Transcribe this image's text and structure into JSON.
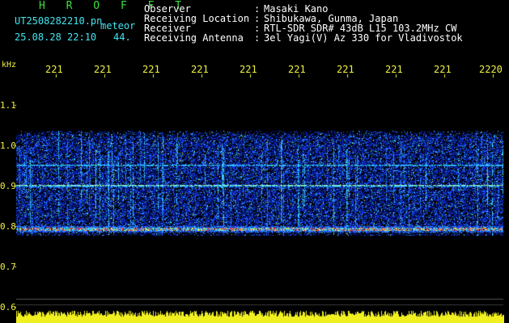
{
  "header": {
    "station": "H R O F F T",
    "file_name": "UT2508282210.pn",
    "category": "meteor",
    "datetime": "25.08.28 22:10",
    "param_value": "44."
  },
  "info": [
    {
      "label": "Observer",
      "value": "Masaki Kano"
    },
    {
      "label": "Receiving Location",
      "value": "Shibukawa, Gunma, Japan"
    },
    {
      "label": "Receiver",
      "value": "RTL-SDR SDR# 43dB L15 103.2MHz CW"
    },
    {
      "label": "Receiving Antenna",
      "value": "3el Yagi(V) Az 330 for Vladivostok"
    }
  ],
  "info_separator": ":",
  "axis": {
    "unit": "kHz",
    "x_ticks": [
      "221",
      "221",
      "221",
      "221",
      "221",
      "221",
      "221",
      "221",
      "221",
      "2220"
    ],
    "y_ticks": [
      "1.1",
      "1.0",
      "0.9",
      "0.8",
      "0.7",
      "0.6"
    ]
  },
  "colors": {
    "background": "#000000",
    "title_green": "#3ce03c",
    "label_cyan": "#44e4f0",
    "tick_yellow": "#f0f044",
    "noise_blue": "#1030ff",
    "signal_red": "#ff2020"
  }
}
